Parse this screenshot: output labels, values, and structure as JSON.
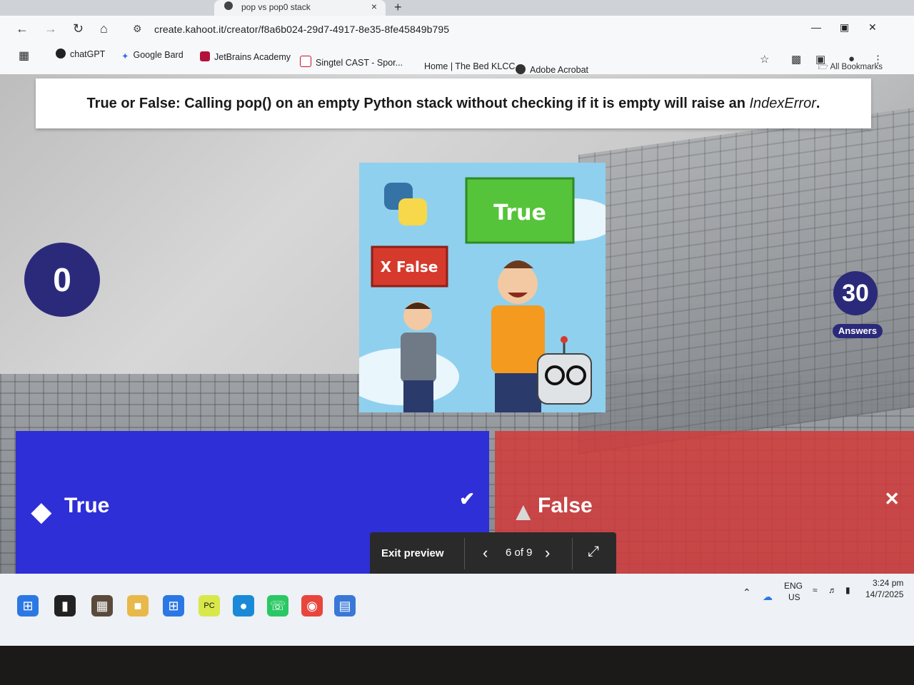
{
  "browser": {
    "tab_title": "pop vs pop0 stack",
    "tab_close": "×",
    "new_tab": "+",
    "url": "create.kahoot.it/creator/f8a6b024-29d7-4917-8e35-8fe45849b795",
    "bookmarks": [
      {
        "label": "chatGPT",
        "icon": "chatgpt-icon",
        "color": "#222222"
      },
      {
        "label": "Google Bard",
        "icon": "bard-icon",
        "color": "#3b6fe0"
      },
      {
        "label": "JetBrains Academy",
        "icon": "jetbrains-icon",
        "color": "#b3123a"
      },
      {
        "label": "Singtel CAST - Spor...",
        "icon": "singtel-icon",
        "color": "#c8102e"
      },
      {
        "label": "Home | The Bed KLCC",
        "icon": "",
        "color": ""
      },
      {
        "label": "Adobe Acrobat",
        "icon": "acrobat-icon",
        "color": "#333333"
      }
    ],
    "all_bookmarks": "All Bookmarks"
  },
  "quiz": {
    "question_lead": "True or False:",
    "question_body": " Calling pop() on an empty Python stack without checking if it is empty will raise an ",
    "question_error": "IndexError",
    "question_end": ".",
    "timer": "0",
    "answers_count": "30",
    "answers_label": "Answers",
    "image_texts": {
      "true_sign": "True",
      "false_sign": "X False"
    },
    "options": [
      {
        "label": "True",
        "shape": "diamond-icon",
        "color": "#2e2fd6",
        "correct": true
      },
      {
        "label": "False",
        "shape": "triangle-icon",
        "color": "#d23a3a",
        "correct": false
      }
    ]
  },
  "preview": {
    "exit_label": "Exit preview",
    "page": "6 of 9"
  },
  "taskbar": {
    "lang1": "ENG",
    "lang2": "US",
    "time": "3:24 pm",
    "date": "14/7/2025"
  }
}
